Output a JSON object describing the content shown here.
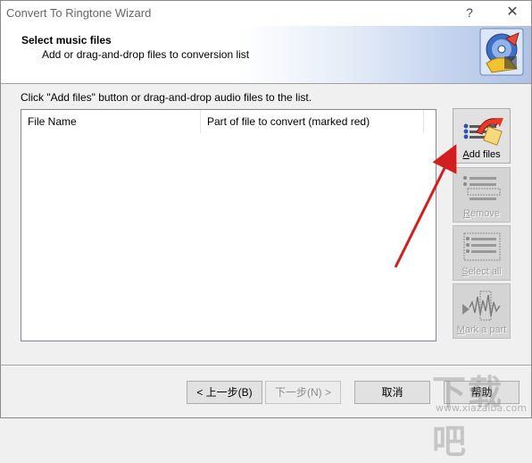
{
  "window": {
    "title": "Convert To Ringtone Wizard",
    "help_glyph": "?",
    "close_glyph": "✕"
  },
  "header": {
    "title": "Select music files",
    "subtitle": "Add or drag-and-drop files to conversion list",
    "icon": "ringtone-wizard-icon"
  },
  "instruction": "Click \"Add files\" button or drag-and-drop audio files to the list.",
  "list": {
    "columns": [
      "File Name",
      "Part of file to convert (marked red)"
    ],
    "rows": []
  },
  "side_buttons": [
    {
      "label": "Add files",
      "enabled": true,
      "icon": "add-files-icon"
    },
    {
      "label": "Remove",
      "enabled": false,
      "icon": "remove-icon"
    },
    {
      "label": "Select all",
      "enabled": false,
      "icon": "select-all-icon"
    },
    {
      "label": "Mark a part",
      "enabled": false,
      "icon": "mark-part-icon"
    }
  ],
  "footer": {
    "back_label": "< 上一步(B)",
    "next_label": "下一步(N) >",
    "cancel_label": "取消",
    "help_label": "帮助"
  },
  "watermark": {
    "text": "下载吧",
    "url": "www.xiazaiba.com"
  },
  "colors": {
    "annotation_arrow": "#d21e1e",
    "header_gradient_end": "#adc2e6"
  }
}
